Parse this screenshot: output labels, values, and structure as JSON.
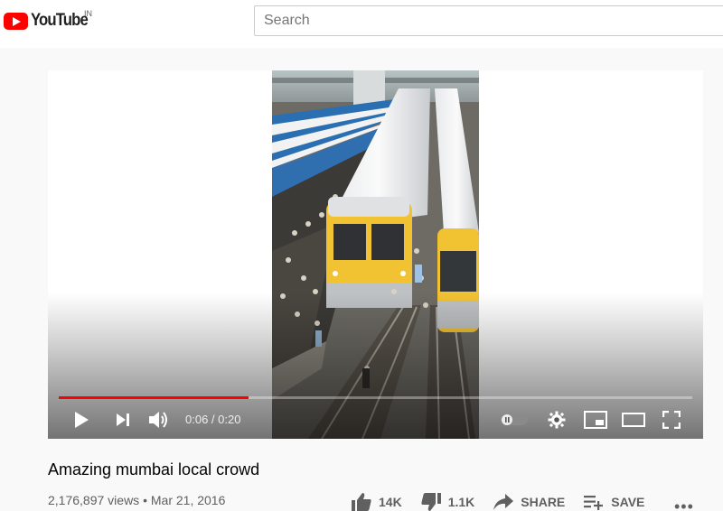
{
  "header": {
    "logo_text": "YouTube",
    "country_code": "IN",
    "search_placeholder": "Search"
  },
  "player": {
    "current_time": "0:06",
    "duration": "0:20",
    "time_separator": " / ",
    "progress_fraction": 0.3,
    "progress_color": "#ff0000"
  },
  "video": {
    "title": "Amazing mumbai local crowd",
    "views": "2,176,897 views",
    "date": "Mar 21, 2016",
    "meta_separator": " • "
  },
  "actions": {
    "like_count": "14K",
    "dislike_count": "1.1K",
    "share_label": "SHARE",
    "save_label": "SAVE"
  }
}
